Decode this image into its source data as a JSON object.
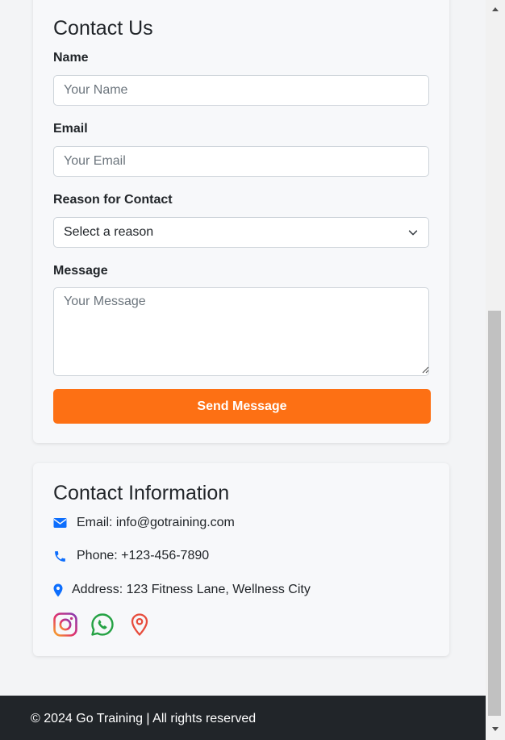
{
  "contact_form": {
    "title": "Contact Us",
    "name_label": "Name",
    "name_placeholder": "Your Name",
    "email_label": "Email",
    "email_placeholder": "Your Email",
    "reason_label": "Reason for Contact",
    "reason_selected": "Select a reason",
    "message_label": "Message",
    "message_placeholder": "Your Message",
    "submit_label": "Send Message"
  },
  "contact_info": {
    "title": "Contact Information",
    "email": "Email: info@gotraining.com",
    "phone": "Phone: +123-456-7890",
    "address": "Address: 123 Fitness Lane, Wellness City",
    "social_icons": [
      "instagram-icon",
      "whatsapp-icon",
      "map-pin-icon"
    ]
  },
  "footer": {
    "text": "© 2024 Go Training | All rights reserved"
  },
  "colors": {
    "accent": "#fd7014",
    "icon_blue": "#0d6efd",
    "footer_bg": "#212529",
    "page_bg": "#f3f4f6"
  }
}
